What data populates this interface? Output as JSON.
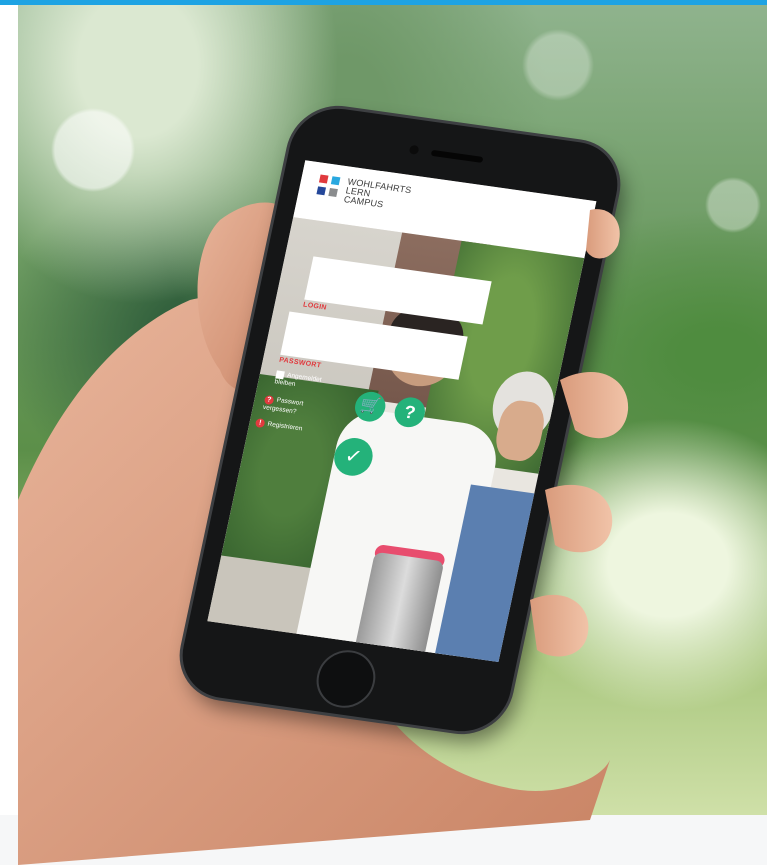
{
  "app": {
    "logo_lines": [
      "WOHLFAHRTS",
      "LERN",
      "CAMPUS"
    ],
    "brand_colors": {
      "red": "#e03a3e",
      "cyan": "#29a8e0",
      "navy": "#24479a",
      "gray": "#8a8c8e",
      "accent_top_bar": "#1ea3e3",
      "button_green": "#24b27a"
    }
  },
  "login_form": {
    "login_label": "LOGIN",
    "password_label": "PASSWORT",
    "remember_label": "Angemeldet bleiben",
    "forgot_label": "Passwort vergessen?",
    "register_label": "Registrieren"
  },
  "icons": {
    "cart": "shopping-cart-icon",
    "help": "help-icon",
    "submit": "checkmark-icon",
    "question": "question-icon",
    "info": "info-icon"
  }
}
